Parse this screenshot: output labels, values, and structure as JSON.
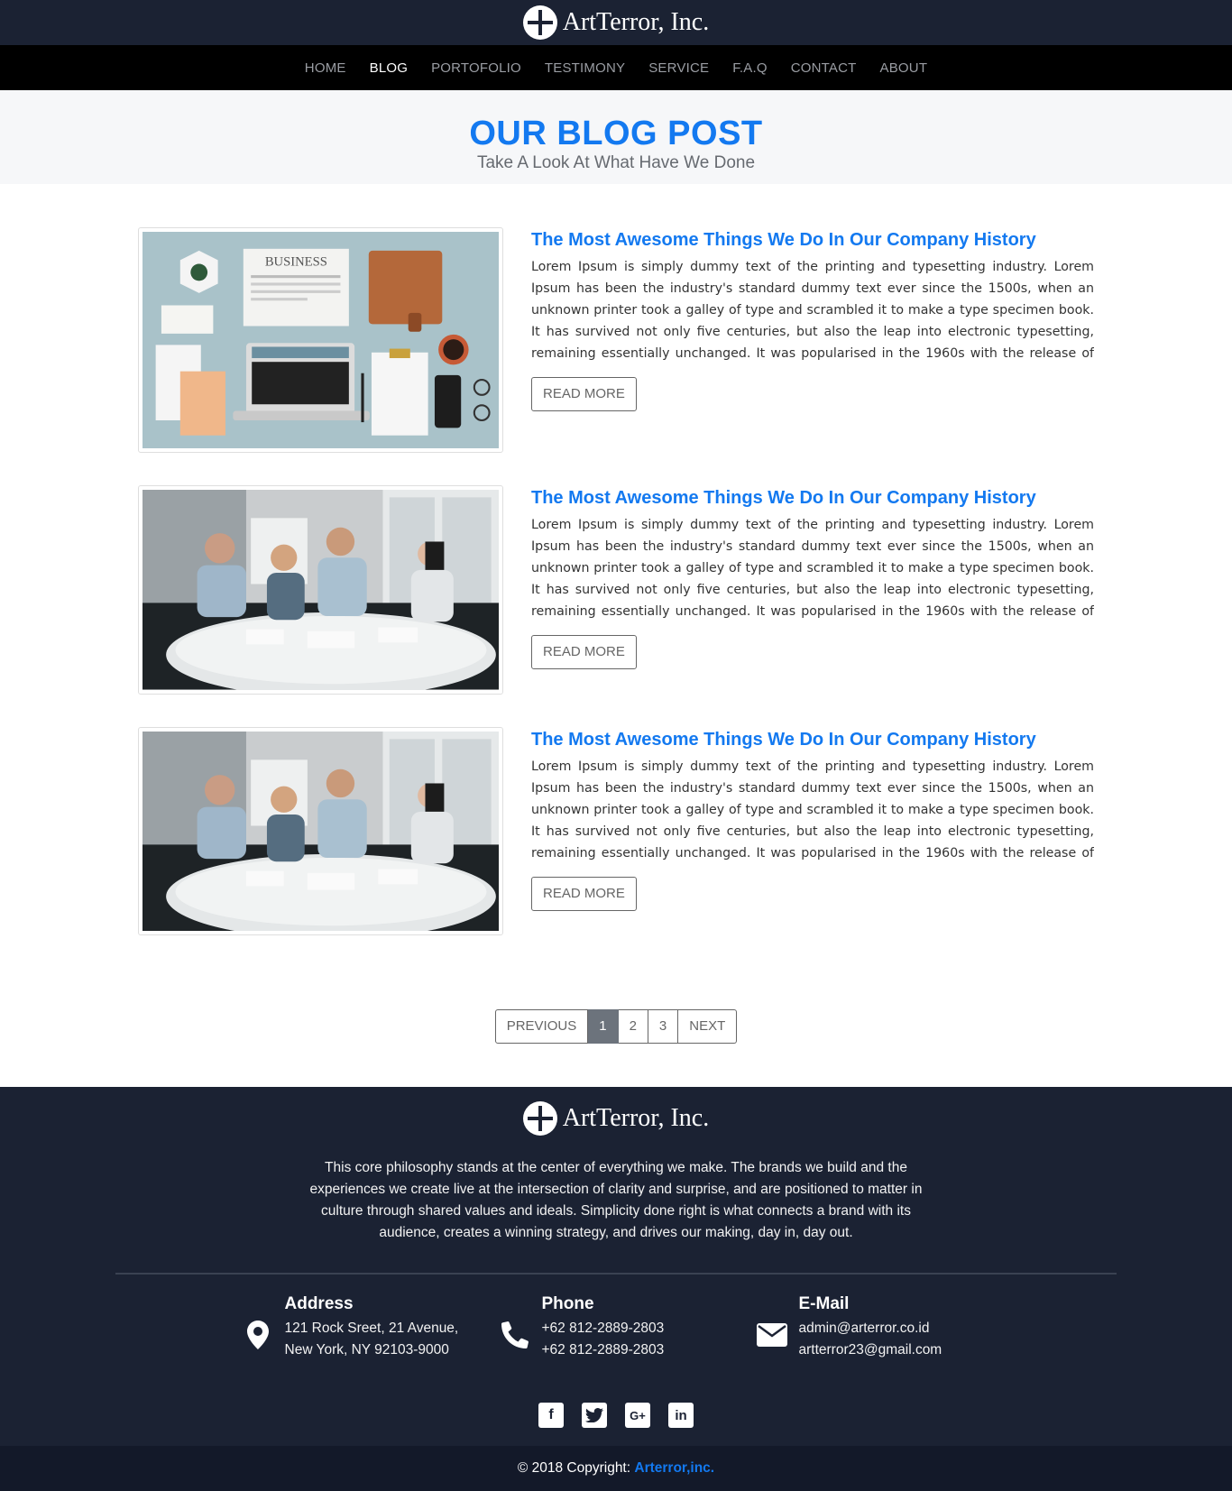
{
  "brand": {
    "name": "ArtTerror, Inc."
  },
  "nav": {
    "items": [
      {
        "label": "HOME"
      },
      {
        "label": "BLOG"
      },
      {
        "label": "PORTOFOLIO"
      },
      {
        "label": "TESTIMONY"
      },
      {
        "label": "SERVICE"
      },
      {
        "label": "F.A.Q"
      },
      {
        "label": "CONTACT"
      },
      {
        "label": "ABOUT"
      }
    ],
    "active": "BLOG"
  },
  "header": {
    "title": "OUR BLOG POST",
    "subtitle": "Take A Look At What Have We Done"
  },
  "posts": [
    {
      "title": "The Most Awesome Things We Do In Our Company History",
      "text": "Lorem Ipsum is simply dummy text of the printing and typesetting industry. Lorem Ipsum has been the industry's standard dummy text ever since the 1500s, when an unknown printer took a galley of type and scrambled it to make a type specimen book. It has survived not only five centuries, but also the leap into electronic typesetting, remaining essentially unchanged. It was popularised in the 1960s with the release of Letraset sheets containing Lorem Ipsum passages, and more recently with deskt...",
      "button": "READ MORE",
      "image_label": "BUSINESS"
    },
    {
      "title": "The Most Awesome Things We Do In Our Company History",
      "text": "Lorem Ipsum is simply dummy text of the printing and typesetting industry. Lorem Ipsum has been the industry's standard dummy text ever since the 1500s, when an unknown printer took a galley of type and scrambled it to make a type specimen book. It has survived not only five centuries, but also the leap into electronic typesetting, remaining essentially unchanged. It was popularised in the 1960s with the release of Letraset sheets containing Lorem Ipsum passages, and more recently with deskt...",
      "button": "READ MORE"
    },
    {
      "title": "The Most Awesome Things We Do In Our Company History",
      "text": "Lorem Ipsum is simply dummy text of the printing and typesetting industry. Lorem Ipsum has been the industry's standard dummy text ever since the 1500s, when an unknown printer took a galley of type and scrambled it to make a type specimen book. It has survived not only five centuries, but also the leap into electronic typesetting, remaining essentially unchanged. It was popularised in the 1960s with the release of Letraset sheets containing Lorem Ipsum passages, and more recently with deskt...",
      "button": "READ MORE"
    }
  ],
  "pagination": {
    "previous": "PREVIOUS",
    "pages": [
      "1",
      "2",
      "3"
    ],
    "current": "1",
    "next": "NEXT"
  },
  "footer": {
    "philosophy": "This core philosophy stands at the center of everything we make. The brands we build and the experiences we create live at the intersection of clarity and surprise, and are positioned to matter in culture through shared values and ideals. Simplicity done right is what connects a brand with its audience, creates a winning strategy, and drives our making, day in, day out.",
    "address": {
      "heading": "Address",
      "line1": "121 Rock Sreet, 21 Avenue,",
      "line2": "New York, NY 92103-9000",
      "icon": "map-marker-icon"
    },
    "phone": {
      "heading": "Phone",
      "line1": "+62 812-2889-2803",
      "line2": "+62 812-2889-2803",
      "icon": "phone-icon"
    },
    "email": {
      "heading": "E-Mail",
      "line1": "admin@arterror.co.id",
      "line2": "artterror23@gmail.com",
      "icon": "envelope-icon"
    },
    "socials": [
      "facebook-icon",
      "twitter-icon",
      "google-plus-icon",
      "linkedin-icon"
    ],
    "copyright_prefix": "© 2018 Copyright:",
    "copyright_owner": "Arterror,inc."
  },
  "colors": {
    "accent": "#1379f0",
    "dark": "#1b2233",
    "nav": "#000000"
  }
}
